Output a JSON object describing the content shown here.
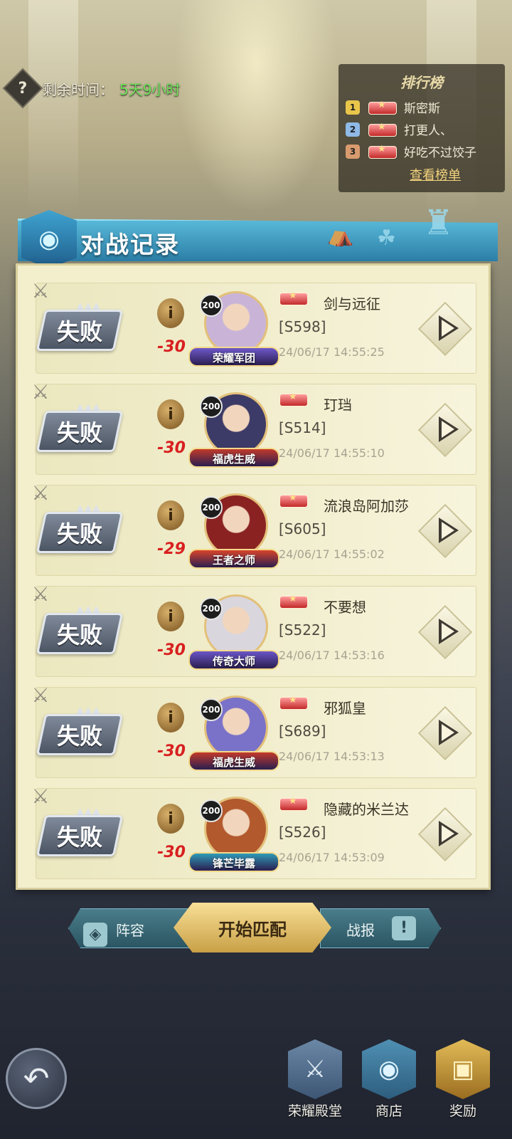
{
  "timer": {
    "label": "剩余时间：",
    "value": "5天9小时"
  },
  "leaderboard": {
    "title": "排行榜",
    "entries": [
      {
        "rank": "1",
        "name": "斯密斯",
        "color": "#e9c64a"
      },
      {
        "rank": "2",
        "name": "打更人、",
        "color": "#8fb9e6"
      },
      {
        "rank": "3",
        "name": "好吃不过饺子",
        "color": "#d89b6e"
      }
    ],
    "view_link": "查看榜单"
  },
  "panel": {
    "title": "对战记录"
  },
  "battles": [
    {
      "result": "失败",
      "score": "-30",
      "level": "200",
      "frame": "荣耀军团",
      "frame_color": "#6d58c9",
      "avatar_color": "#c9b4d8",
      "name": "剑与远征",
      "server": "[S598]",
      "time": "24/06/17 14:55:25"
    },
    {
      "result": "失败",
      "score": "-30",
      "level": "200",
      "frame": "福虎生威",
      "frame_color": "#c13a2a",
      "avatar_color": "#3c3a66",
      "name": "玎珰",
      "server": "[S514]",
      "time": "24/06/17 14:55:10"
    },
    {
      "result": "失败",
      "score": "-29",
      "level": "200",
      "frame": "王者之师",
      "frame_color": "#d8442a",
      "avatar_color": "#8a2222",
      "name": "流浪岛阿加莎",
      "server": "[S605]",
      "time": "24/06/17 14:55:02"
    },
    {
      "result": "失败",
      "score": "-30",
      "level": "200",
      "frame": "传奇大师",
      "frame_color": "#6a55c7",
      "avatar_color": "#d9d6de",
      "name": "不要想",
      "server": "[S522]",
      "time": "24/06/17 14:53:16"
    },
    {
      "result": "失败",
      "score": "-30",
      "level": "200",
      "frame": "福虎生威",
      "frame_color": "#c13a2a",
      "avatar_color": "#7a72c8",
      "name": "邪狐皇",
      "server": "[S689]",
      "time": "24/06/17 14:53:13"
    },
    {
      "result": "失败",
      "score": "-30",
      "level": "200",
      "frame": "锋芒毕露",
      "frame_color": "#2f9ab7",
      "avatar_color": "#b2592e",
      "name": "隐藏的米兰达",
      "server": "[S526]",
      "time": "24/06/17 14:53:09"
    }
  ],
  "actions": {
    "lineup": "阵容",
    "start_match": "开始匹配",
    "report": "战报"
  },
  "nav": {
    "hall": "荣耀殿堂",
    "shop": "商店",
    "rewards": "奖励"
  }
}
